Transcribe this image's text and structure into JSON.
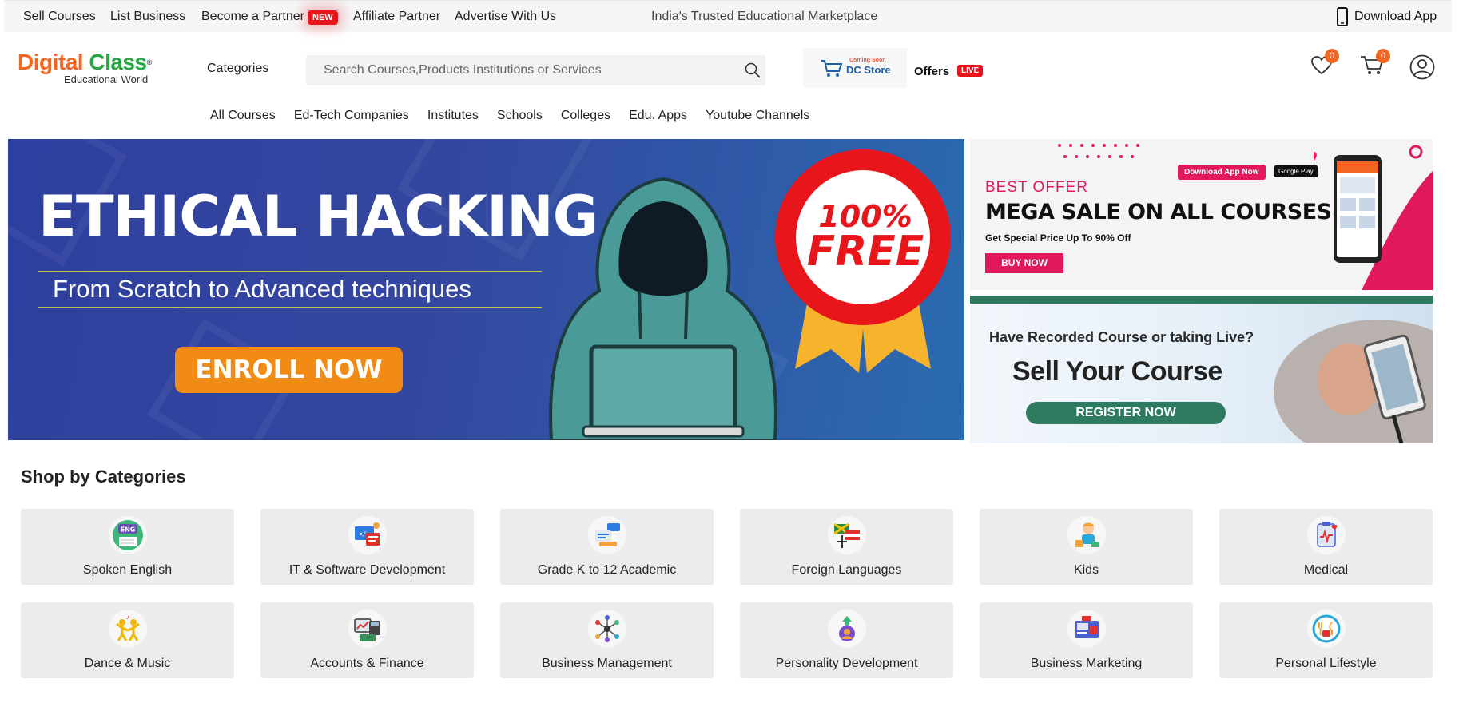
{
  "topbar": {
    "links": [
      "Sell Courses",
      "List Business",
      "Become a Partner",
      "Affiliate Partner",
      "Advertise With Us"
    ],
    "new_badge": "NEW",
    "tagline": "India's Trusted Educational Marketplace",
    "download_app": "Download App"
  },
  "header": {
    "logo_main_1": "Digital",
    "logo_main_2": " Class",
    "logo_reg": "®",
    "logo_sub": "Educational World",
    "categories_label": "Categories",
    "search_placeholder": "Search Courses,Products Institutions or Services",
    "dc_store_soon": "Coming Soon",
    "dc_store_name": "DC Store",
    "offers_label": "Offers",
    "live_badge": "LIVE",
    "wishlist_count": "0",
    "cart_count": "0"
  },
  "nav": {
    "items": [
      "All Courses",
      "Ed-Tech Companies",
      "Institutes",
      "Schools",
      "Colleges",
      "Edu. Apps",
      "Youtube Channels"
    ]
  },
  "hero": {
    "title": "ETHICAL HACKING",
    "subtitle": "From Scratch to Advanced techniques",
    "cta": "ENROLL NOW",
    "seal_top": "100%",
    "seal_bottom": "FREE"
  },
  "promo1": {
    "kicker": "BEST OFFER",
    "headline": "MEGA SALE ON ALL COURSES",
    "sub": "Get Special Price Up To 90% Off",
    "cta": "BUY NOW",
    "download_btn": "Download App Now",
    "gplay": "Google Play"
  },
  "promo2": {
    "kicker": "Have Recorded Course or taking Live?",
    "headline": "Sell Your Course",
    "cta": "REGISTER NOW"
  },
  "categories": {
    "title": "Shop by Categories",
    "items": [
      {
        "label": "Spoken English",
        "icon": "eng-icon",
        "color": "#6a4fb5"
      },
      {
        "label": "IT & Software Development",
        "icon": "code-icon",
        "color": "#2c7be5"
      },
      {
        "label": "Grade K to 12 Academic",
        "icon": "academic-icon",
        "color": "#2c7be5"
      },
      {
        "label": "Foreign Languages",
        "icon": "flags-icon",
        "color": "#e0312f"
      },
      {
        "label": "Kids",
        "icon": "kids-icon",
        "color": "#f2a33a"
      },
      {
        "label": "Medical",
        "icon": "medical-icon",
        "color": "#e0312f"
      },
      {
        "label": "Dance & Music",
        "icon": "dance-icon",
        "color": "#f2b705"
      },
      {
        "label": "Accounts & Finance",
        "icon": "finance-icon",
        "color": "#3a8f5a"
      },
      {
        "label": "Business Management",
        "icon": "network-icon",
        "color": "#4a5fd0"
      },
      {
        "label": "Personality Development",
        "icon": "growth-icon",
        "color": "#7a4fd0"
      },
      {
        "label": "Business Marketing",
        "icon": "marketing-icon",
        "color": "#2c7be5"
      },
      {
        "label": "Personal Lifestyle",
        "icon": "lifestyle-icon",
        "color": "#2aa8d8"
      }
    ]
  }
}
